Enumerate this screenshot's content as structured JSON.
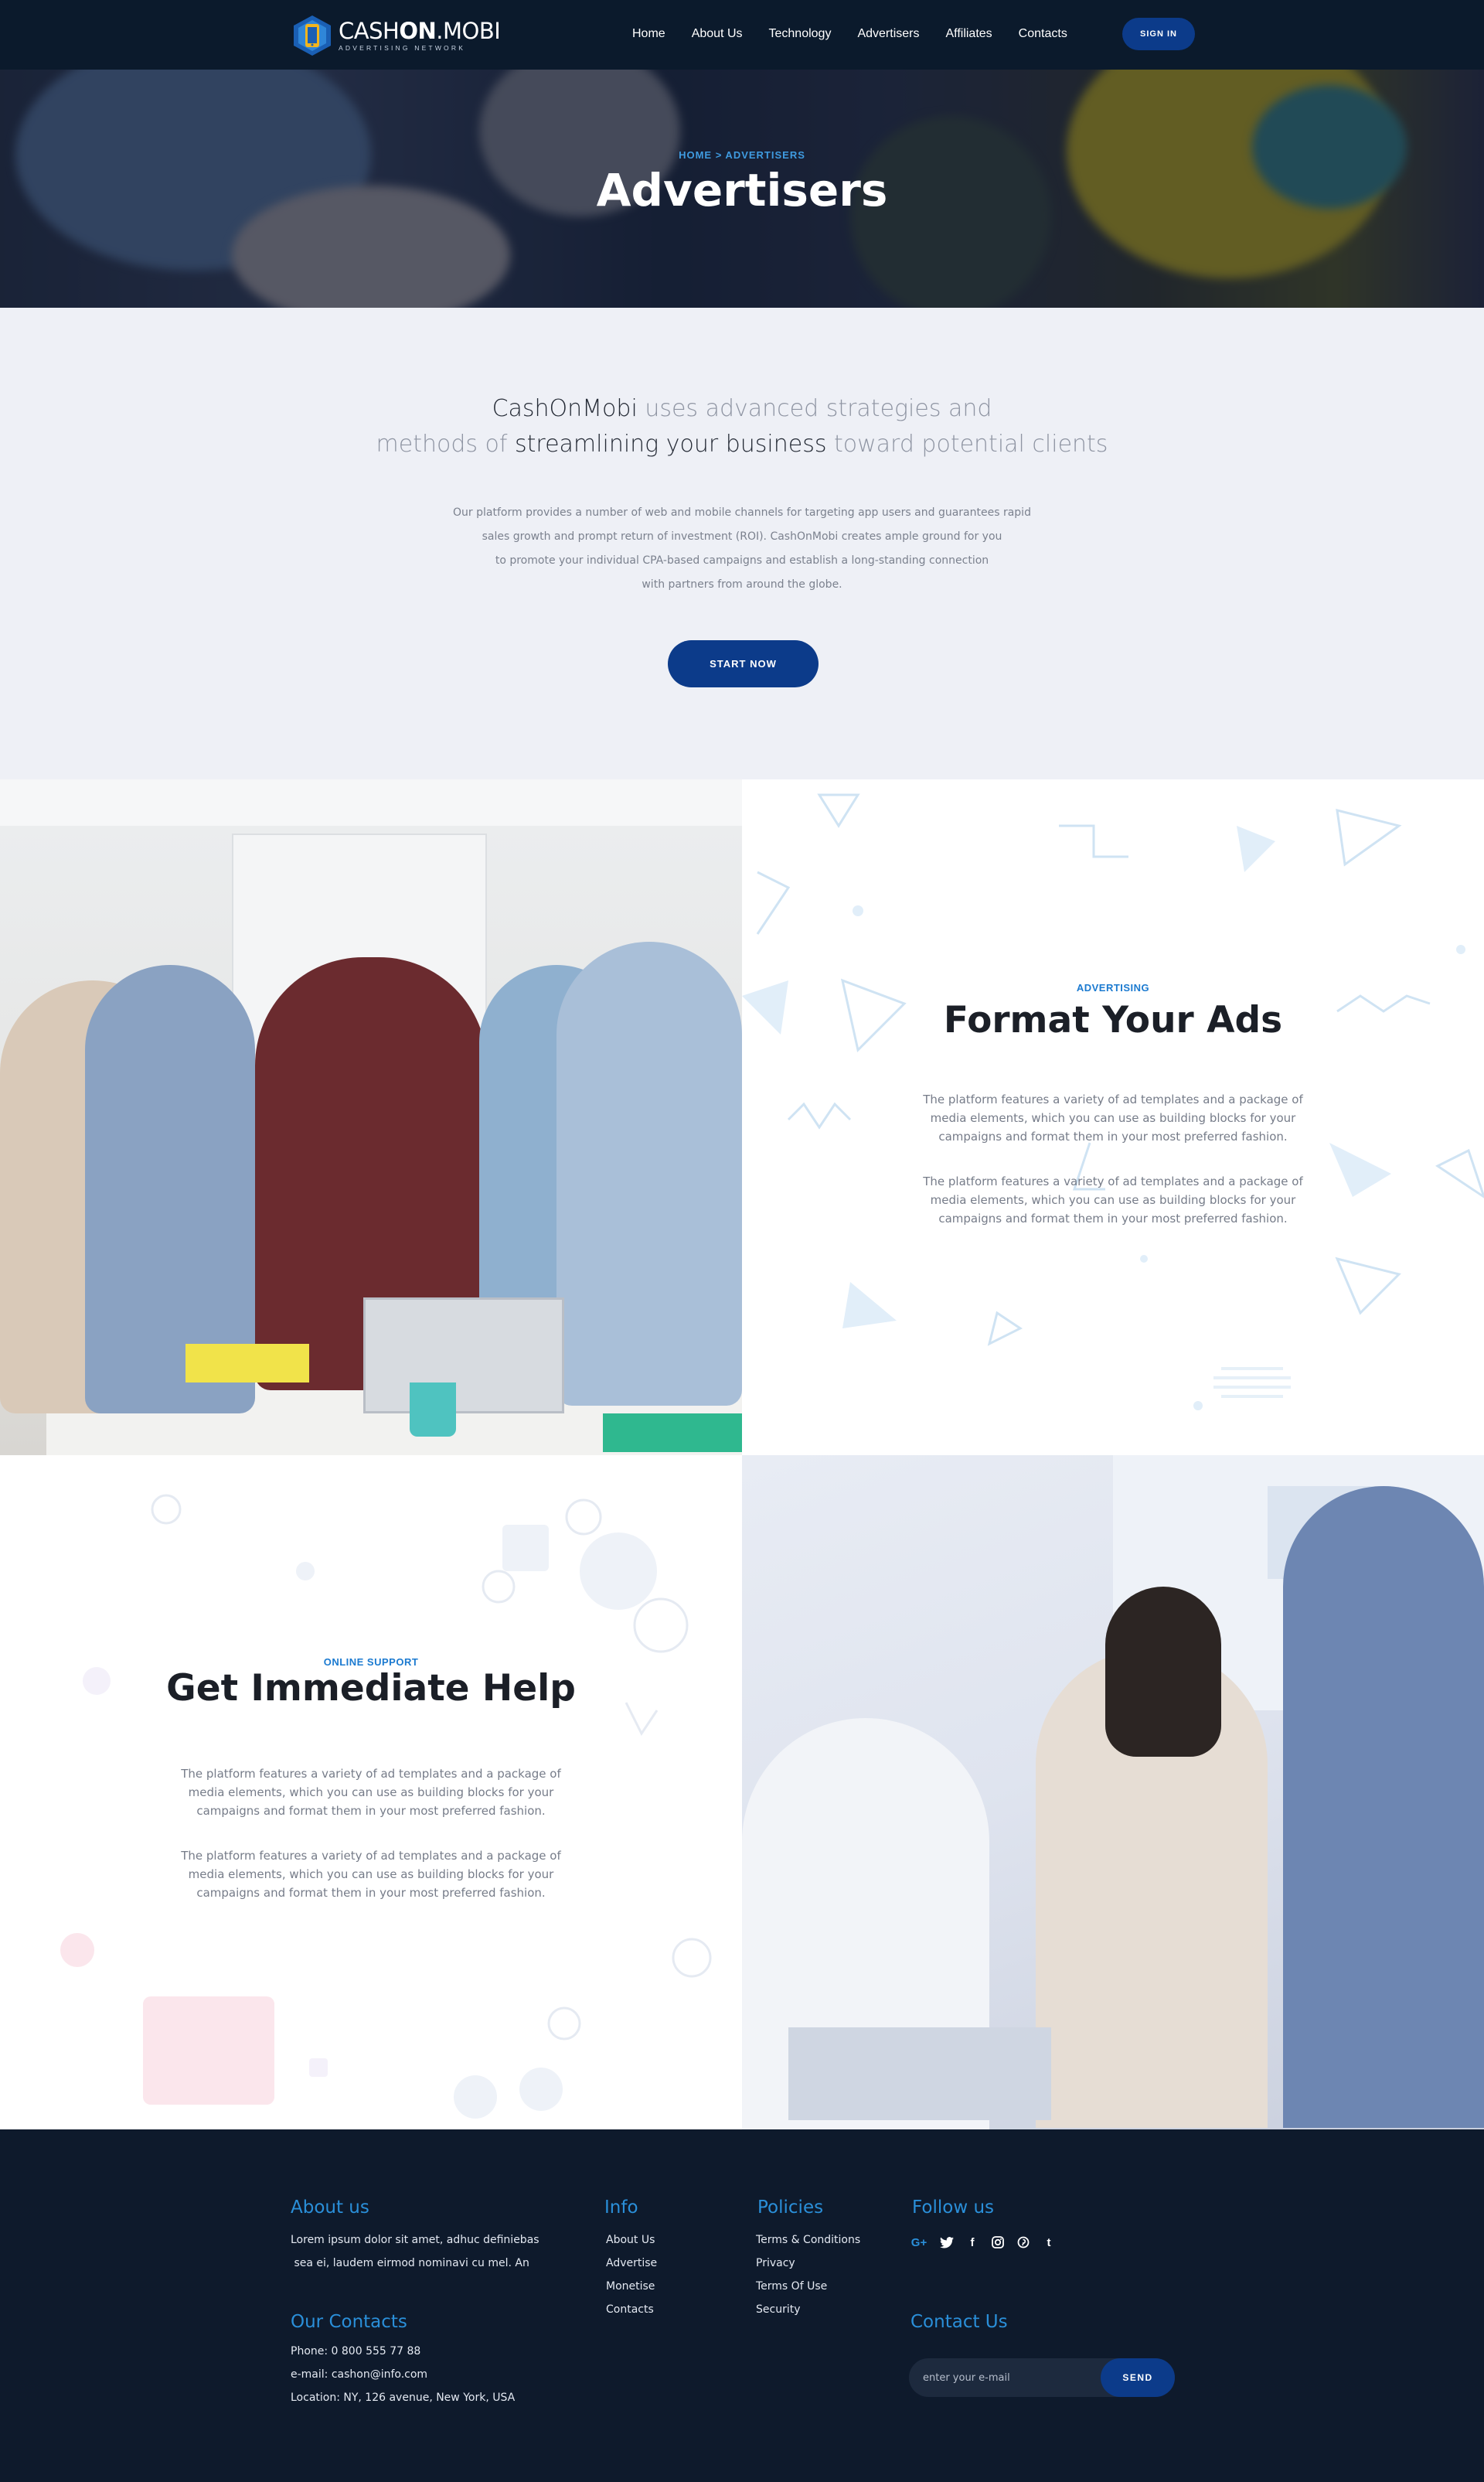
{
  "header": {
    "logo": {
      "name_light": "CASH",
      "name_bold": "ON",
      "name_suffix": ".MOBI",
      "tagline": "ADVERTISING NETWORK"
    },
    "nav": [
      {
        "label": "Home"
      },
      {
        "label": "About Us"
      },
      {
        "label": "Technology"
      },
      {
        "label": "Advertisers"
      },
      {
        "label": "Affiliates"
      },
      {
        "label": "Contacts"
      }
    ],
    "signin_label": "SIGN IN"
  },
  "hero": {
    "breadcrumb": "HOME > ADVERTISERS",
    "title": "Advertisers"
  },
  "intro": {
    "lead": {
      "brand": "CashOnMobi",
      "part1": " uses advanced strategies and",
      "part2": "methods of ",
      "highlight": "streamlining your business",
      "part3": " toward potential clients"
    },
    "body": [
      "Our platform provides a number of web and mobile channels for targeting app users and guarantees rapid",
      "sales growth and prompt return of investment (ROI). CashOnMobi creates ample ground for you",
      "to promote your individual CPA-based campaigns and establish a long-standing connection",
      "with partners from around the globe."
    ],
    "cta_label": "START NOW"
  },
  "features": [
    {
      "eyebrow": "ADVERTISING",
      "title": "Format Your Ads",
      "paragraphs": [
        "The platform features a variety of ad templates and a package of media elements, which you can use as building blocks for your campaigns and format them in your most preferred fashion.",
        "The platform features a variety of ad templates and a package of media elements, which you can use as building blocks for your campaigns and format them in your most preferred fashion."
      ]
    },
    {
      "eyebrow": "ONLINE SUPPORT",
      "title": "Get Immediate Help",
      "paragraphs": [
        "The platform features a variety of ad templates and a package of media elements, which you can use as building blocks for your campaigns and format them in your most preferred fashion.",
        "The platform features a variety of ad templates and a package of media elements, which you can use as building blocks for your campaigns and format them in your most preferred fashion."
      ]
    }
  ],
  "footer": {
    "about": {
      "heading": "About us",
      "lines": [
        "Lorem ipsum dolor sit amet, adhuc definiebas",
        " sea ei, laudem eirmod nominavi cu mel. An"
      ]
    },
    "contacts": {
      "heading": "Our Contacts",
      "phone": "Phone: 0 800 555 77 88",
      "email": "e-mail: cashon@info.com",
      "location": "Location: NY, 126 avenue, New York, USA"
    },
    "info": {
      "heading": "Info",
      "links": [
        "About Us",
        "Advertise",
        "Monetise",
        "Contacts"
      ]
    },
    "policies": {
      "heading": "Policies",
      "links": [
        "Terms & Conditions",
        "Privacy",
        "Terms Of Use",
        "Security"
      ]
    },
    "follow": {
      "heading": "Follow us",
      "icons": [
        {
          "name": "google-plus-icon",
          "glyph": "G+"
        },
        {
          "name": "twitter-icon",
          "glyph": ""
        },
        {
          "name": "facebook-icon",
          "glyph": "f"
        },
        {
          "name": "instagram-icon",
          "glyph": ""
        },
        {
          "name": "pinterest-icon",
          "glyph": ""
        },
        {
          "name": "tumblr-icon",
          "glyph": "t"
        }
      ]
    },
    "contact_us": {
      "heading": "Contact Us",
      "placeholder": "enter your e-mail",
      "send_label": "SEND"
    }
  },
  "colors": {
    "accent": "#0c3b8a",
    "link_blue": "#2a8fd9",
    "header_bg": "#0b1a2c",
    "footer_bg": "#0e1a2c",
    "intro_bg": "#eef0f6"
  }
}
